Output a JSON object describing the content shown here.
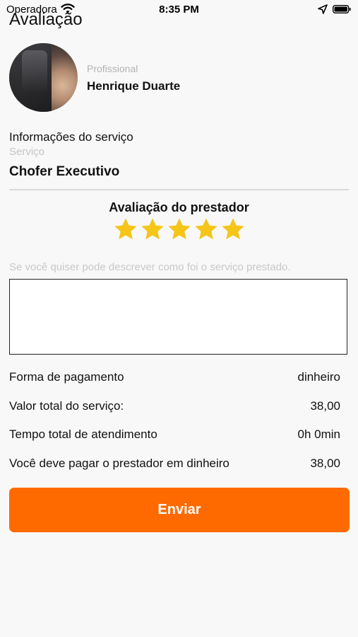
{
  "status_bar": {
    "carrier": "Operadora",
    "time": "8:35 PM"
  },
  "header": {
    "title": "Avaliação"
  },
  "professional": {
    "label": "Profissional",
    "name": "Henrique Duarte"
  },
  "service_info": {
    "section_title": "Informações do serviço",
    "service_label": "Serviço",
    "service_value": "Chofer Executivo"
  },
  "rating": {
    "title": "Avaliação do prestador",
    "stars": 5,
    "max_stars": 5,
    "star_color": "#f5c518"
  },
  "comment": {
    "placeholder": "Se você quiser pode descrever como foi o serviço prestado.",
    "value": ""
  },
  "payment": {
    "rows": [
      {
        "label": "Forma de pagamento",
        "value": "dinheiro"
      },
      {
        "label": "Valor total do serviço:",
        "value": "38,00"
      },
      {
        "label": "Tempo total de atendimento",
        "value": "0h 0min"
      },
      {
        "label": "Você deve pagar o prestador em dinheiro",
        "value": "38,00"
      }
    ]
  },
  "submit": {
    "label": "Enviar",
    "color": "#ff6a00"
  }
}
